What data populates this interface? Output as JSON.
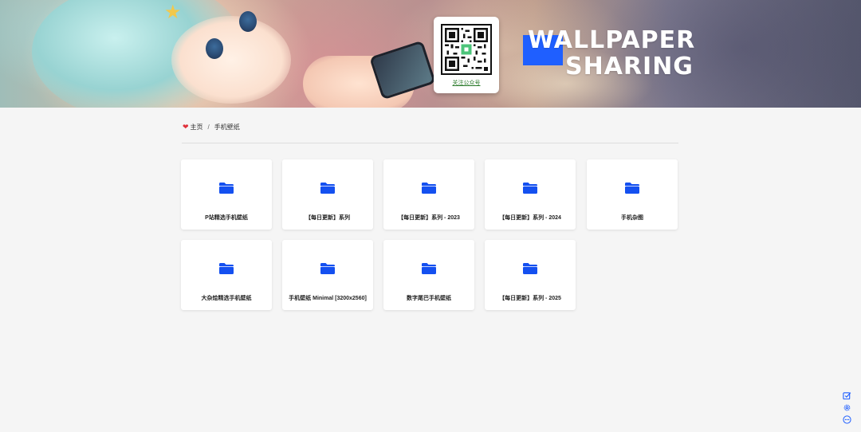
{
  "banner": {
    "qr_label": "关注公众号",
    "title_line1": "WALLPAPER",
    "title_line2": "SHARING",
    "accent_color": "#1f5fff"
  },
  "breadcrumb": {
    "home_icon": "heart-icon",
    "home": "主页",
    "separator": "/",
    "current": "手机壁纸"
  },
  "folders": [
    {
      "label": "P站精选手机壁纸",
      "icon": "folder-icon"
    },
    {
      "label": "【每日更新】系列",
      "icon": "folder-icon"
    },
    {
      "label": "【每日更新】系列 - 2023",
      "icon": "folder-icon"
    },
    {
      "label": "【每日更新】系列 - 2024",
      "icon": "folder-icon"
    },
    {
      "label": "手机杂图",
      "icon": "folder-icon"
    },
    {
      "label": "大杂烩精选手机壁纸",
      "icon": "folder-icon"
    },
    {
      "label": "手机壁纸 Minimal [3200x2560]",
      "icon": "folder-icon"
    },
    {
      "label": "数字尾巴手机壁纸",
      "icon": "folder-icon"
    },
    {
      "label": "【每日更新】系列 - 2025",
      "icon": "folder-icon"
    }
  ],
  "folder_color": "#1450f0",
  "tools": [
    "edit-check-icon",
    "settings-icon",
    "more-icon"
  ]
}
